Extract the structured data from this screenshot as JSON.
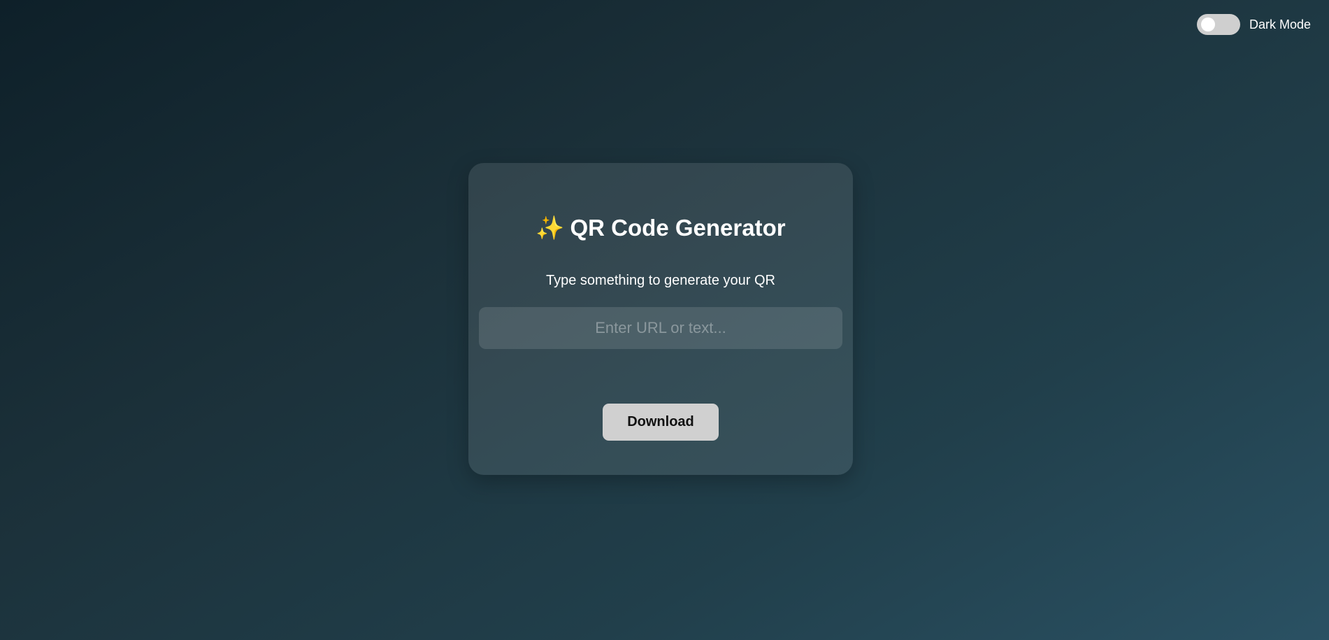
{
  "theme_toggle": {
    "label": "Dark Mode",
    "checked": false
  },
  "card": {
    "title_icon": "✨",
    "title_icon_name": "sparkles-icon",
    "title": "QR Code Generator",
    "subtitle": "Type something to generate your QR",
    "input": {
      "value": "",
      "placeholder": "Enter URL or text..."
    },
    "download_label": "Download"
  },
  "colors": {
    "background_start": "#0e2029",
    "background_end": "#2a5163",
    "button_bg": "#d0d0d0",
    "toggle_track": "#cfcfcf",
    "sparkle": "#f4c542"
  }
}
